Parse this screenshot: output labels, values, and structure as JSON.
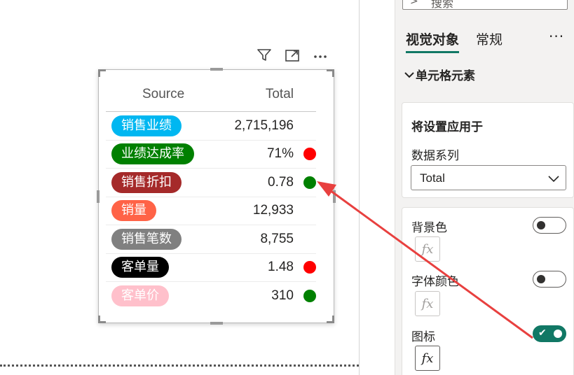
{
  "visual_header": {
    "filter_icon": "filter-icon",
    "focus_icon": "focus-mode-icon",
    "more_icon": "more-options-icon"
  },
  "table": {
    "headers": {
      "source": "Source",
      "total": "Total"
    },
    "rows": [
      {
        "label": "销售业绩",
        "value": "2,715,196",
        "pill_color": "#00B7F1",
        "label_color": "#ffffff",
        "dot": null
      },
      {
        "label": "业绩达成率",
        "value": "71%",
        "pill_color": "#008000",
        "label_color": "#ffffff",
        "dot": "#FF0000"
      },
      {
        "label": "销售折扣",
        "value": "0.78",
        "pill_color": "#A52A2A",
        "label_color": "#ffffff",
        "dot": "#008000"
      },
      {
        "label": "销量",
        "value": "12,933",
        "pill_color": "#FF6347",
        "label_color": "#ffffff",
        "dot": null
      },
      {
        "label": "销售笔数",
        "value": "8,755",
        "pill_color": "#808080",
        "label_color": "#ffffff",
        "dot": null
      },
      {
        "label": "客单量",
        "value": "1.48",
        "pill_color": "#000000",
        "label_color": "#ffffff",
        "dot": "#FF0000"
      },
      {
        "label": "客单价",
        "value": "310",
        "pill_color": "#FFC0CB",
        "label_color": "#ffffff",
        "dot": "#008000"
      }
    ]
  },
  "pane": {
    "search_text": "搜索",
    "tabs": [
      {
        "label": "视觉对象",
        "active": true
      },
      {
        "label": "常规",
        "active": false
      }
    ],
    "more": "···",
    "section_title": "单元格元素",
    "apply_card": {
      "title": "将设置应用于",
      "series_label": "数据系列",
      "series_value": "Total"
    },
    "options": {
      "background": {
        "label": "背景色",
        "on": false
      },
      "font_color": {
        "label": "字体颜色",
        "on": false
      },
      "icon": {
        "label": "图标",
        "on": true
      }
    },
    "fx_label": "fx",
    "accent_color": "#117865",
    "annotation_arrow_color": "#E8403F"
  }
}
